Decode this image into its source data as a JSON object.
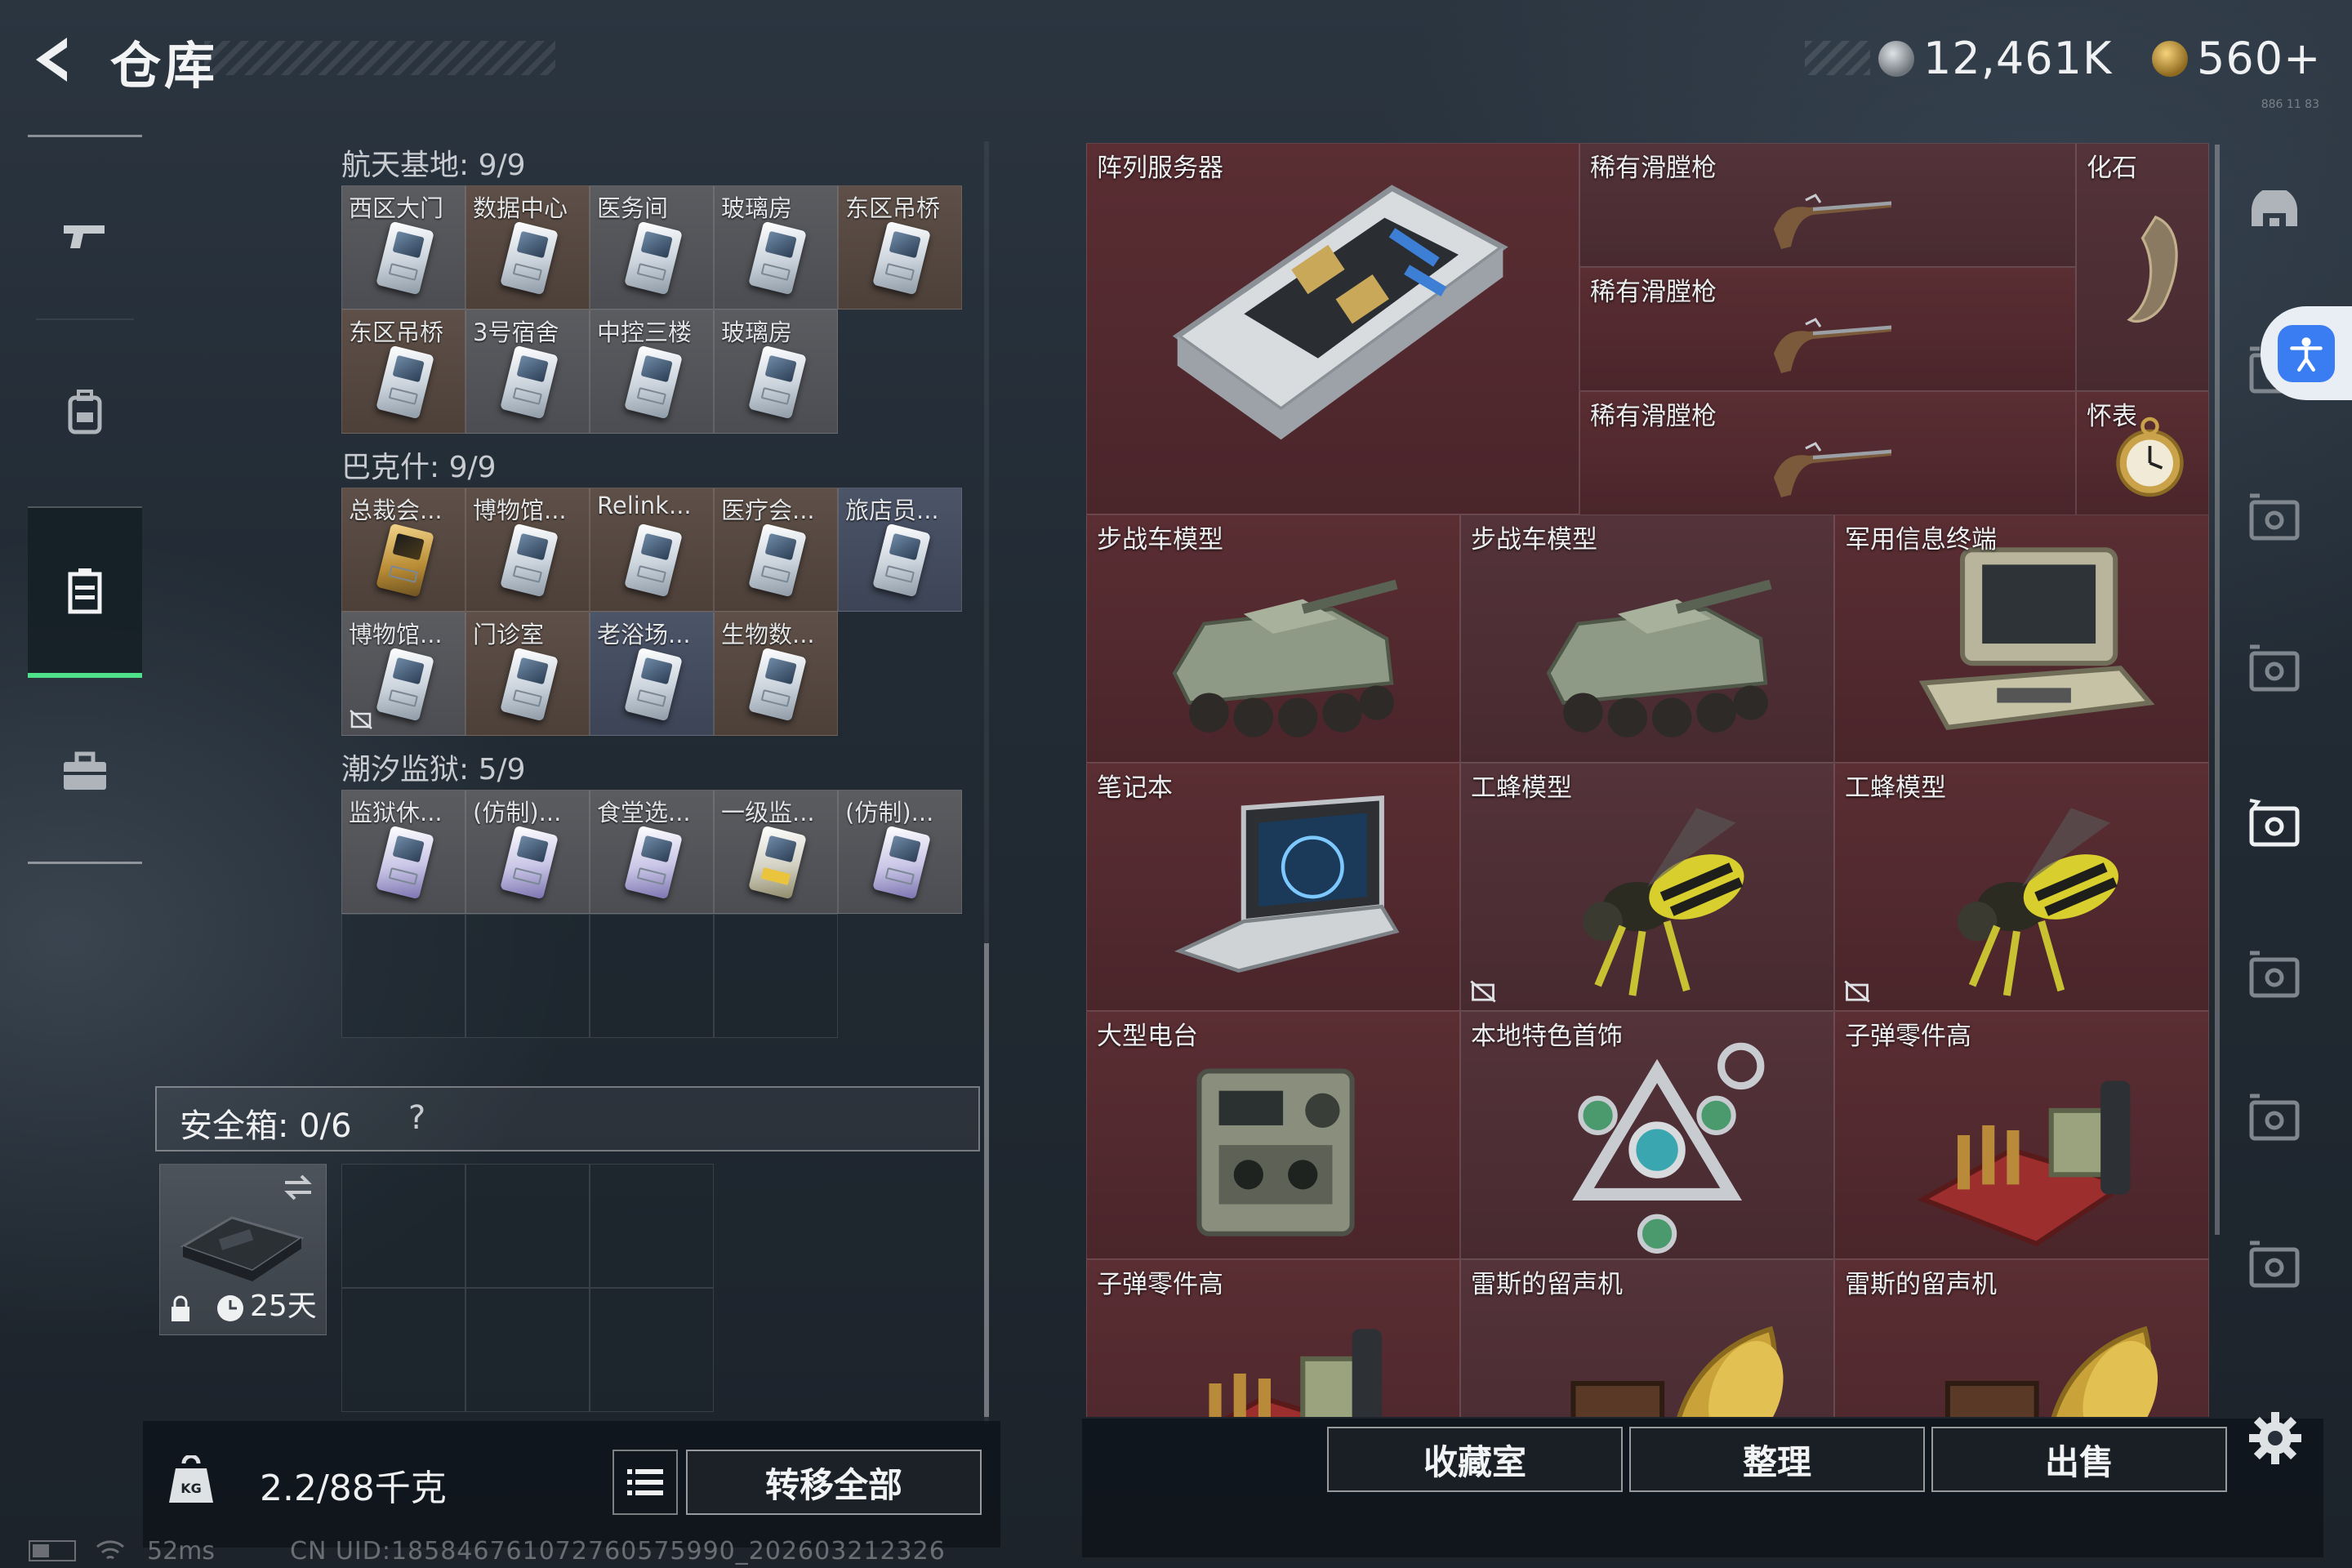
{
  "header": {
    "title": "仓库",
    "currency": {
      "silver": "12,461K",
      "gold": "560+"
    },
    "version_text": "886 11 83"
  },
  "nav": {
    "items": [
      "weapons-tab",
      "backpack-tab",
      "warehouse-tab",
      "briefcase-tab"
    ],
    "active": "warehouse-tab"
  },
  "sections": [
    {
      "title": "航天基地: 9/9",
      "cells": [
        {
          "label": "西区大门",
          "style": "grey",
          "card": "white"
        },
        {
          "label": "数据中心",
          "style": "brown",
          "card": "white"
        },
        {
          "label": "医务间",
          "style": "grey",
          "card": "white"
        },
        {
          "label": "玻璃房",
          "style": "grey",
          "card": "white"
        },
        {
          "label": "东区吊桥",
          "style": "brown",
          "card": "white"
        },
        {
          "label": "东区吊桥",
          "style": "brown",
          "card": "white"
        },
        {
          "label": "3号宿舍",
          "style": "grey",
          "card": "white"
        },
        {
          "label": "中控三楼",
          "style": "grey",
          "card": "white"
        },
        {
          "label": "玻璃房",
          "style": "grey",
          "card": "white"
        }
      ]
    },
    {
      "title": "巴克什: 9/9",
      "cells": [
        {
          "label": "总裁会...",
          "style": "brown",
          "card": "gold"
        },
        {
          "label": "博物馆...",
          "style": "brown",
          "card": "white"
        },
        {
          "label": "Relink...",
          "style": "brown",
          "card": "white"
        },
        {
          "label": "医疗会...",
          "style": "brown",
          "card": "white"
        },
        {
          "label": "旅店员...",
          "style": "blue",
          "card": "white"
        },
        {
          "label": "博物馆...",
          "style": "grey",
          "card": "white",
          "locked": true
        },
        {
          "label": "门诊室",
          "style": "brown",
          "card": "white"
        },
        {
          "label": "老浴场...",
          "style": "blue",
          "card": "white"
        },
        {
          "label": "生物数...",
          "style": "brown",
          "card": "white"
        }
      ]
    },
    {
      "title": "潮汐监狱: 5/9",
      "cells": [
        {
          "label": "监狱休...",
          "style": "grey",
          "card": "violet"
        },
        {
          "label": "(仿制)...",
          "style": "grey",
          "card": "violet"
        },
        {
          "label": "食堂选...",
          "style": "grey",
          "card": "violet"
        },
        {
          "label": "一级监...",
          "style": "grey",
          "card": "yellowtag"
        },
        {
          "label": "(仿制)...",
          "style": "grey",
          "card": "violet"
        },
        {
          "label": "",
          "style": "empty"
        },
        {
          "label": "",
          "style": "empty"
        },
        {
          "label": "",
          "style": "empty"
        },
        {
          "label": "",
          "style": "empty"
        }
      ]
    }
  ],
  "safe_box": {
    "label": "安全箱: 0/6",
    "help": "?",
    "days": "25天"
  },
  "weight": {
    "value": "2.2/88千克",
    "icon_text": "KG"
  },
  "buttons": {
    "transfer_all": "转移全部",
    "collection": "收藏室",
    "sort": "整理",
    "sell": "出售"
  },
  "inventory": [
    {
      "name": "阵列服务器",
      "art": "server"
    },
    {
      "name": "稀有滑膛枪",
      "art": "musket"
    },
    {
      "name": "稀有滑膛枪",
      "art": "musket"
    },
    {
      "name": "稀有滑膛枪",
      "art": "musket"
    },
    {
      "name": "化石",
      "art": "fossil"
    },
    {
      "name": "怀表",
      "art": "watch"
    },
    {
      "name": "步战车模型",
      "art": "ifv"
    },
    {
      "name": "步战车模型",
      "art": "ifv"
    },
    {
      "name": "军用信息终端",
      "art": "terminal"
    },
    {
      "name": "笔记本",
      "art": "laptop"
    },
    {
      "name": "工蜂模型",
      "art": "wasp",
      "locked": true
    },
    {
      "name": "工蜂模型",
      "art": "wasp",
      "locked": true
    },
    {
      "name": "大型电台",
      "art": "radio"
    },
    {
      "name": "本地特色首饰",
      "art": "jewelry"
    },
    {
      "name": "子弹零件高",
      "art": "ammo"
    },
    {
      "name": "子弹零件高",
      "art": "ammo"
    },
    {
      "name": "雷斯的留声机",
      "art": "phonograph"
    },
    {
      "name": "雷斯的留声机",
      "art": "phonograph"
    }
  ],
  "right_tabs": [
    "home-tab",
    "tab-g1",
    "tab-g2",
    "tab-g4",
    "tab-g5",
    "tab-g6",
    "tab-g7",
    "tab-g8",
    "tab-g9"
  ],
  "status": {
    "ping": "52ms",
    "uid": "CN UID:1858467610727605759​90_202603212326"
  },
  "colors": {
    "accent_green": "#4fe08a",
    "item_red": "#5a2e33",
    "card_grey": "#5b5c60"
  }
}
